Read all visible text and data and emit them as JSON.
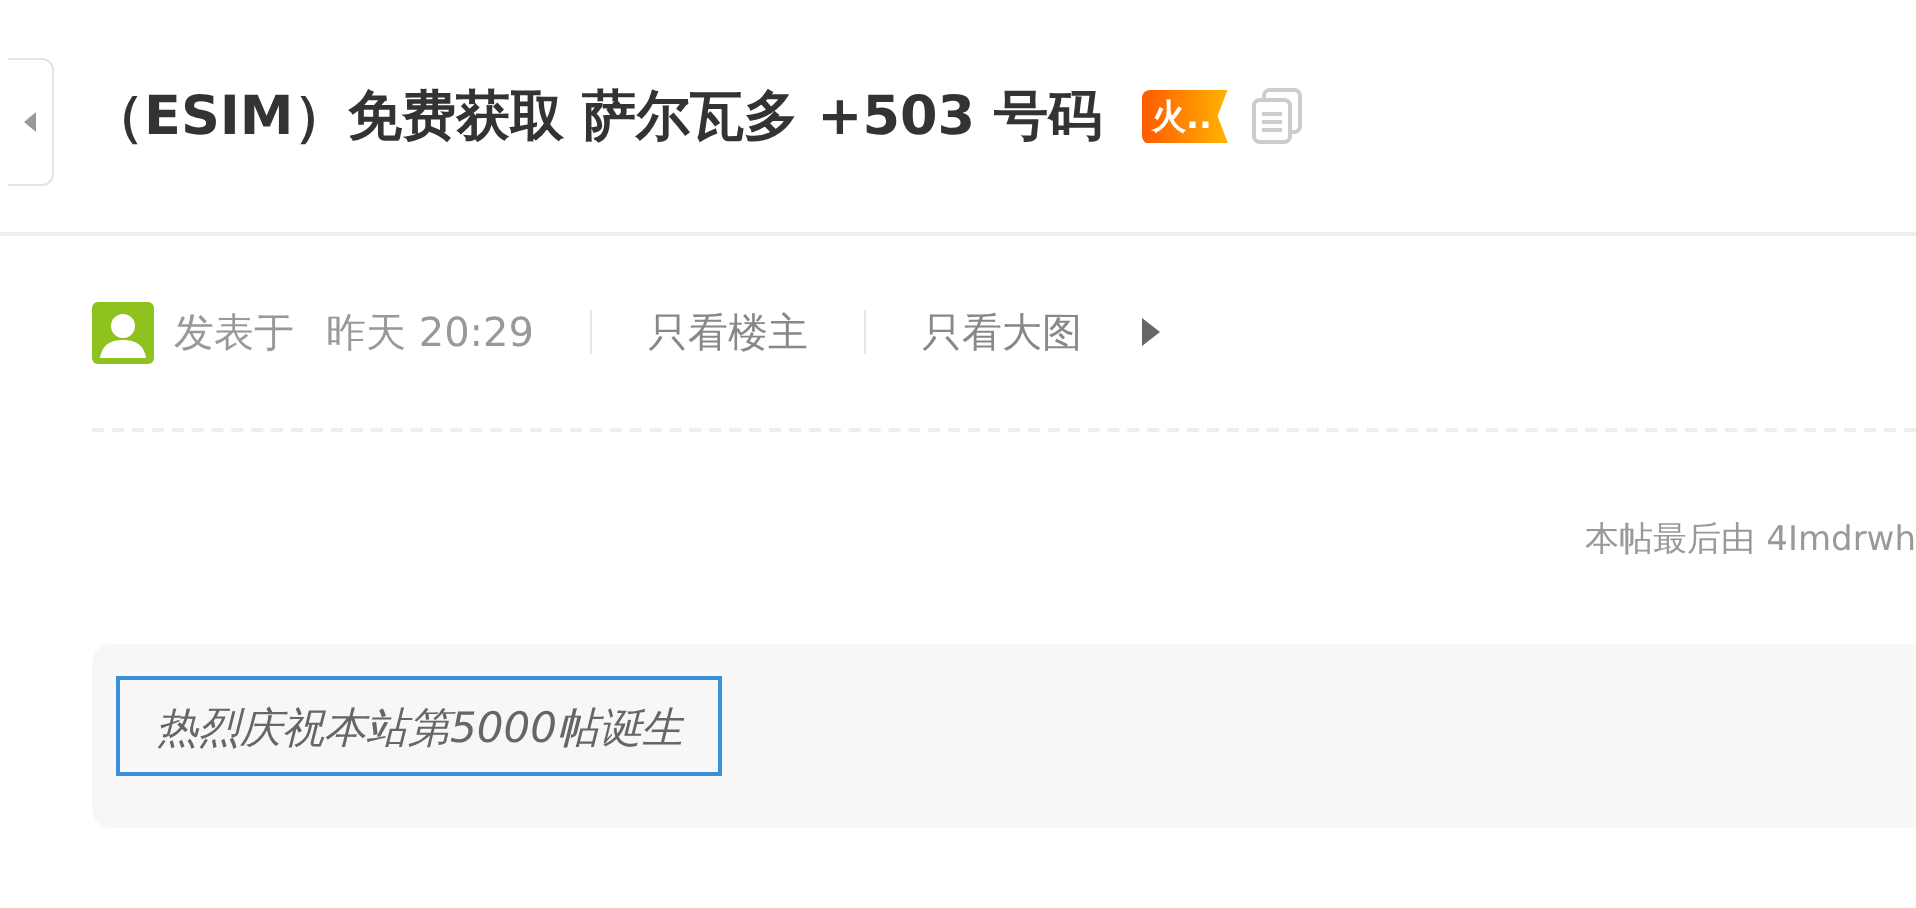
{
  "thread": {
    "title": "（ESIM）免费获取 萨尔瓦多 +503 号码",
    "badge": "火.."
  },
  "post_meta": {
    "posted_label": "发表于",
    "time": "昨天 20:29",
    "links": [
      "只看楼主",
      "只看大图"
    ]
  },
  "edit_note": "本帖最后由 4Imdrwh",
  "quote": {
    "text": "热烈庆祝本站第5000帖诞生"
  }
}
